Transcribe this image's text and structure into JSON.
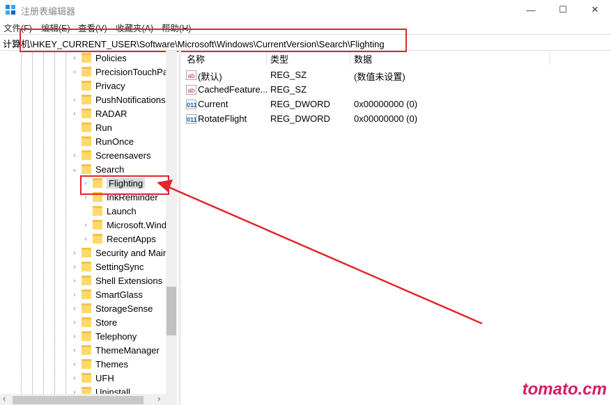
{
  "window": {
    "title": "注册表编辑器",
    "minimize": "—",
    "maximize": "☐",
    "close": "✕"
  },
  "menu": [
    "文件(F)",
    "编辑(E)",
    "查看(V)",
    "收藏夹(A)",
    "帮助(H)"
  ],
  "address": "计算机\\HKEY_CURRENT_USER\\Software\\Microsoft\\Windows\\CurrentVersion\\Search\\Flighting",
  "tree": {
    "items": [
      {
        "label": "Policies",
        "level": 1,
        "expander": "›"
      },
      {
        "label": "PrecisionTouchPa",
        "level": 1,
        "expander": "›"
      },
      {
        "label": "Privacy",
        "level": 1,
        "expander": ""
      },
      {
        "label": "PushNotifications",
        "level": 1,
        "expander": "›"
      },
      {
        "label": "RADAR",
        "level": 1,
        "expander": "›"
      },
      {
        "label": "Run",
        "level": 1,
        "expander": ""
      },
      {
        "label": "RunOnce",
        "level": 1,
        "expander": ""
      },
      {
        "label": "Screensavers",
        "level": 1,
        "expander": "›"
      },
      {
        "label": "Search",
        "level": 1,
        "expander": "⌄"
      },
      {
        "label": "Flighting",
        "level": 2,
        "expander": "›",
        "selected": true
      },
      {
        "label": "InkReminder",
        "level": 2,
        "expander": "›"
      },
      {
        "label": "Launch",
        "level": 2,
        "expander": ""
      },
      {
        "label": "Microsoft.Wind",
        "level": 2,
        "expander": "›"
      },
      {
        "label": "RecentApps",
        "level": 2,
        "expander": "›"
      },
      {
        "label": "Security and Main",
        "level": 1,
        "expander": "›"
      },
      {
        "label": "SettingSync",
        "level": 1,
        "expander": "›"
      },
      {
        "label": "Shell Extensions",
        "level": 1,
        "expander": "›"
      },
      {
        "label": "SmartGlass",
        "level": 1,
        "expander": "›"
      },
      {
        "label": "StorageSense",
        "level": 1,
        "expander": "›"
      },
      {
        "label": "Store",
        "level": 1,
        "expander": "›"
      },
      {
        "label": "Telephony",
        "level": 1,
        "expander": "›"
      },
      {
        "label": "ThemeManager",
        "level": 1,
        "expander": "›"
      },
      {
        "label": "Themes",
        "level": 1,
        "expander": "›"
      },
      {
        "label": "UFH",
        "level": 1,
        "expander": "›"
      },
      {
        "label": "Uninstall",
        "level": 1,
        "expander": "›"
      }
    ],
    "scroll_left": "‹",
    "scroll_right": "›"
  },
  "list": {
    "columns": [
      "名称",
      "类型",
      "数据"
    ],
    "rows": [
      {
        "icon": "ab",
        "name": "(默认)",
        "type": "REG_SZ",
        "data": "(数值未设置)"
      },
      {
        "icon": "ab",
        "name": "CachedFeature...",
        "type": "REG_SZ",
        "data": ""
      },
      {
        "icon": "011",
        "name": "Current",
        "type": "REG_DWORD",
        "data": "0x00000000 (0)"
      },
      {
        "icon": "011",
        "name": "RotateFlight",
        "type": "REG_DWORD",
        "data": "0x00000000 (0)"
      }
    ]
  },
  "watermark": "tomato.cm",
  "colors": {
    "annotation": "#e0262c",
    "watermark": "#d81b60",
    "folder": "#ffd96a"
  }
}
